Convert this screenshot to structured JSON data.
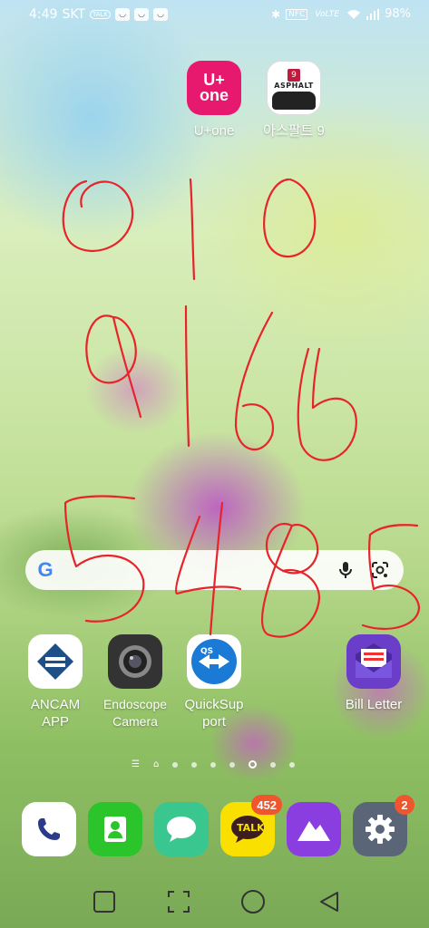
{
  "status_bar": {
    "time": "4:49",
    "carrier": "SKT",
    "talk_tag": "TALK",
    "nfc_tag": "NFC",
    "volte_tag": "VoLTE",
    "battery": "98%"
  },
  "top_apps": [
    {
      "label": "U+one",
      "icon_text": "U+\none"
    },
    {
      "label": "아스팔트 9",
      "icon_text": "ASPHALT",
      "icon_number": "9"
    }
  ],
  "search": {
    "google_letter": "G"
  },
  "mid_apps": [
    {
      "label": "ANCAM\nAPP"
    },
    {
      "label": "Endoscope\nCamera"
    },
    {
      "label": "QuickSup\nport",
      "icon_text": "QS"
    },
    {
      "label": "Bill Letter"
    }
  ],
  "page_indicator": {
    "pages": 7,
    "current": 6
  },
  "dock": {
    "phone": {
      "name": "phone"
    },
    "contacts": {
      "name": "contacts"
    },
    "messages": {
      "name": "messages"
    },
    "kakaotalk": {
      "icon_text": "TALK",
      "badge": "452"
    },
    "gallery": {
      "name": "gallery"
    },
    "settings": {
      "badge": "2"
    }
  },
  "colors": {
    "uplus": "#e6196e",
    "kakao": "#f9e000",
    "scribble": "#e8232a",
    "badge": "#f0562d"
  }
}
